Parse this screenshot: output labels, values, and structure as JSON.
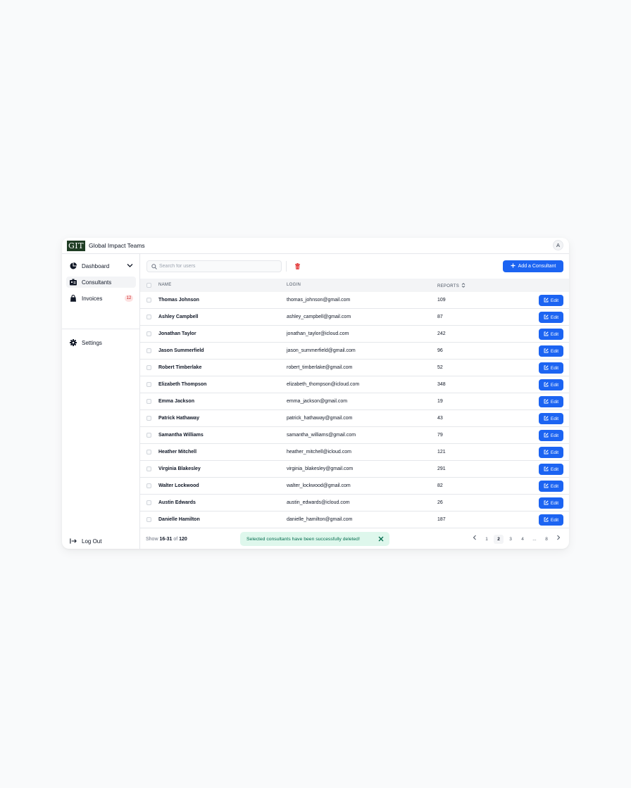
{
  "app": {
    "logo_text": "GIT",
    "title": "Global Impact Teams",
    "avatar_initial": "A"
  },
  "sidebar": {
    "items": [
      {
        "label": "Dashboard",
        "icon": "pie-chart-icon"
      },
      {
        "label": "Consultants",
        "icon": "id-card-icon"
      },
      {
        "label": "Invoices",
        "icon": "shopping-bag-icon",
        "badge": "12"
      },
      {
        "label": "Settings",
        "icon": "gear-icon"
      }
    ],
    "logout_label": "Log Out"
  },
  "toolbar": {
    "search_placeholder": "Search for users",
    "add_label": "Add a Consultant"
  },
  "table": {
    "headers": {
      "name": "NAME",
      "login": "LOGIN",
      "reports": "REPORTS"
    },
    "edit_label": "Edit",
    "rows": [
      {
        "name": "Thomas Johnson",
        "login": "thomas_johnson@gmail.com",
        "reports": "109"
      },
      {
        "name": "Ashley Campbell",
        "login": "ashley_campbell@gmail.com",
        "reports": "87"
      },
      {
        "name": "Jonathan Taylor",
        "login": "jonathan_taylor@icloud.com",
        "reports": "242"
      },
      {
        "name": "Jason Summerfield",
        "login": "jason_summerfield@gmail.com",
        "reports": "96"
      },
      {
        "name": "Robert Timberlake",
        "login": "robert_timberlake@gmail.com",
        "reports": "52"
      },
      {
        "name": "Elizabeth Thompson",
        "login": "elizabeth_thompson@icloud.com",
        "reports": "348"
      },
      {
        "name": "Emma Jackson",
        "login": "emma_jackson@gmail.com",
        "reports": "19"
      },
      {
        "name": "Patrick Hathaway",
        "login": "patrick_hathaway@gmail.com",
        "reports": "43"
      },
      {
        "name": "Samantha Williams",
        "login": "samantha_williams@gmail.com",
        "reports": "79"
      },
      {
        "name": "Heather Mitchell",
        "login": "heather_mitchell@icloud.com",
        "reports": "121"
      },
      {
        "name": "Virginia Blakesley",
        "login": "virginia_blakesley@gmail.com",
        "reports": "291"
      },
      {
        "name": "Walter Lockwood",
        "login": "walter_lockwood@gmail.com",
        "reports": "82"
      },
      {
        "name": "Austin Edwards",
        "login": "austin_edwards@icloud.com",
        "reports": "26"
      },
      {
        "name": "Danielle Hamilton",
        "login": "danielle_hamilton@gmail.com",
        "reports": "187"
      }
    ]
  },
  "footer": {
    "show_prefix": "Show",
    "range": "16-31",
    "of": "of",
    "total": "120",
    "toast": "Selected consultants have been successfully deleted!",
    "pages": [
      "1",
      "2",
      "3",
      "4",
      "...",
      "8"
    ],
    "current_page": "2"
  },
  "colors": {
    "primary": "#1c64f2",
    "logo_bg": "#1f3d24",
    "danger": "#e02424",
    "toast_bg": "#def7ec",
    "toast_text": "#046c4e"
  }
}
